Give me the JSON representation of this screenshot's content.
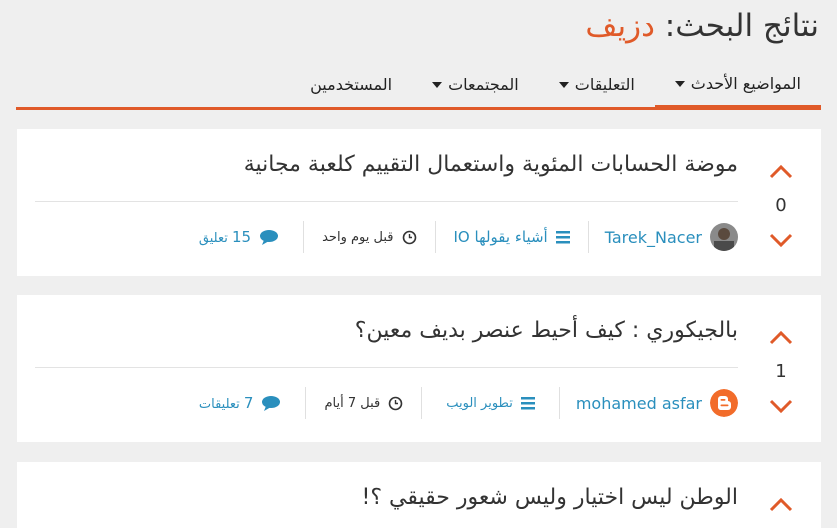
{
  "search": {
    "title_prefix": "نتائج البحث:",
    "query": "دزيف"
  },
  "tabs": [
    {
      "label": "المواضيع الأحدث",
      "has_dropdown": true,
      "active": true
    },
    {
      "label": "التعليقات",
      "has_dropdown": true,
      "active": false
    },
    {
      "label": "المجتمعات",
      "has_dropdown": true,
      "active": false
    },
    {
      "label": "المستخدمين",
      "has_dropdown": false,
      "active": false
    }
  ],
  "results": [
    {
      "title": "موضة الحسابات المئوية واستعمال التقييم كلعبة مجانية",
      "votes": "0",
      "author": "Tarek_Nacer",
      "community": "أشياء يقولها IO",
      "time": "قبل يوم واحد",
      "comments_count": "15",
      "comments_label": "تعليق"
    },
    {
      "title": "بالجيكوري : كيف أحيط عنصر بديف معين؟",
      "votes": "1",
      "author": "mohamed asfar",
      "community": "تطوير الويب",
      "time": "قبل 7 أيام",
      "comments_count": "7",
      "comments_label": "تعليقات"
    },
    {
      "title": "الوطن ليس اختيار وليس شعور حقيقي ؟!"
    }
  ],
  "colors": {
    "accent": "#e05a29",
    "link": "#2a8fbd"
  },
  "icons": {
    "upvote": "chevron-up-icon",
    "downvote": "chevron-down-icon",
    "community": "list-icon",
    "time": "clock-icon",
    "comments": "comment-bubble-icon"
  }
}
